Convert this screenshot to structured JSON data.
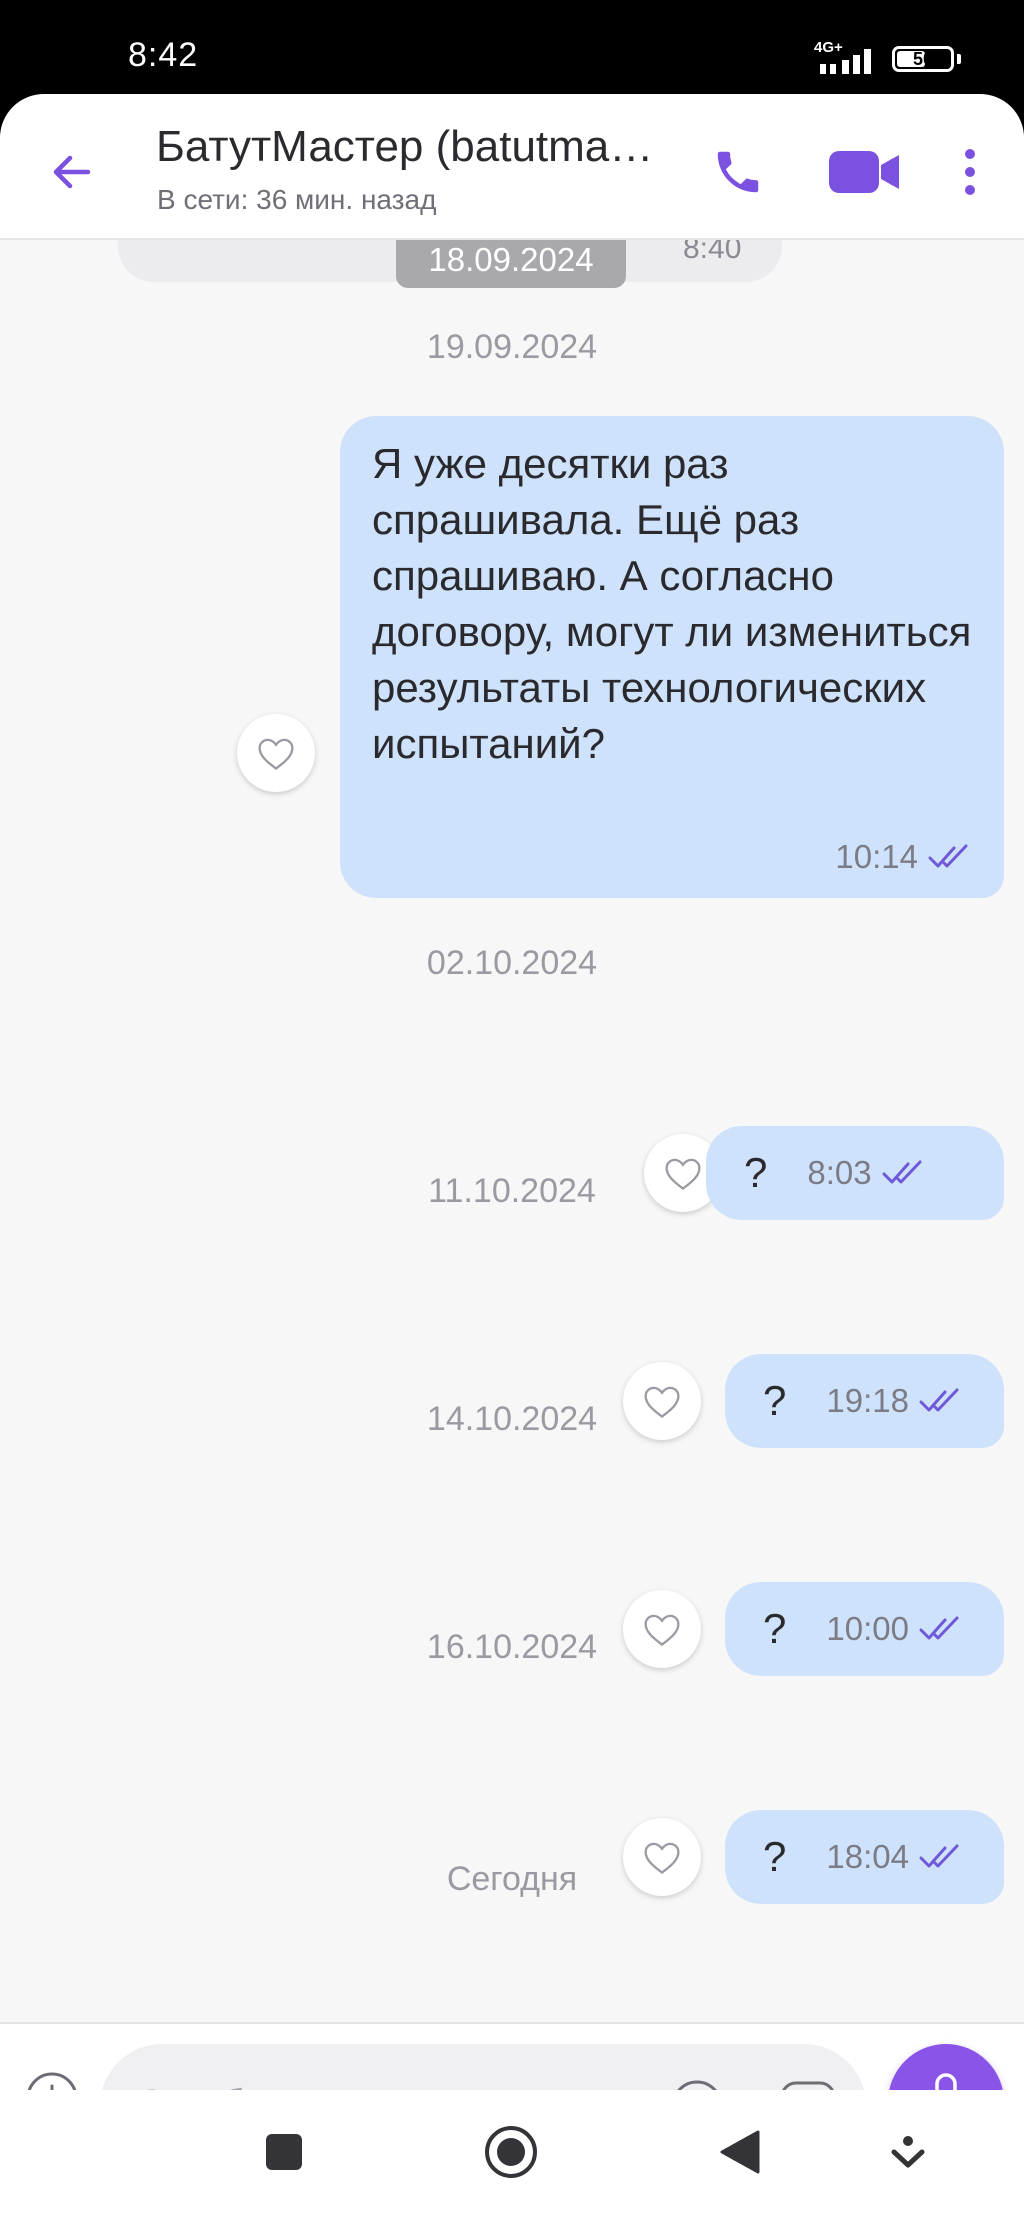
{
  "status_bar": {
    "time": "8:42",
    "network": "4G+",
    "battery": "50"
  },
  "header": {
    "title": "БатутМастер (batutmaster)",
    "presence": "В сети: 36 мин. назад"
  },
  "previous": {
    "date_chip": "18.09.2024",
    "time_fragment": "8:40"
  },
  "messages": [
    {
      "date": "19.09.2024",
      "text": "Я уже десятки раз спрашивала. Ещё раз спрашиваю. А согласно договору, могут ли измениться результаты технологических испытаний?",
      "time": "10:14",
      "status": "read"
    },
    {
      "date": "02.10.2024",
      "text": "?",
      "time": "8:03",
      "status": "read"
    },
    {
      "date": "11.10.2024",
      "text": "?",
      "time": "19:18",
      "status": "read"
    },
    {
      "date": "14.10.2024",
      "text": "?",
      "time": "10:00",
      "status": "read"
    },
    {
      "date": "16.10.2024",
      "text": "?",
      "time": "18:04",
      "status": "read"
    }
  ],
  "today_label": "Сегодня",
  "composer": {
    "placeholder": "Сообщение...",
    "value": ""
  },
  "colors": {
    "accent": "#7b52e0",
    "bubble_outgoing": "#cfe2fb",
    "read_check": "#6f58d9",
    "mic_button": "#8a54e8"
  },
  "icons": {
    "back": "arrow-left-icon",
    "call": "phone-icon",
    "video": "video-camera-icon",
    "more": "more-vertical-icon",
    "like": "heart-icon",
    "read": "double-check-icon",
    "attach": "plus-circle-icon",
    "emoji": "smile-icon",
    "sticker": "sticker-icon",
    "mic": "microphone-icon"
  }
}
